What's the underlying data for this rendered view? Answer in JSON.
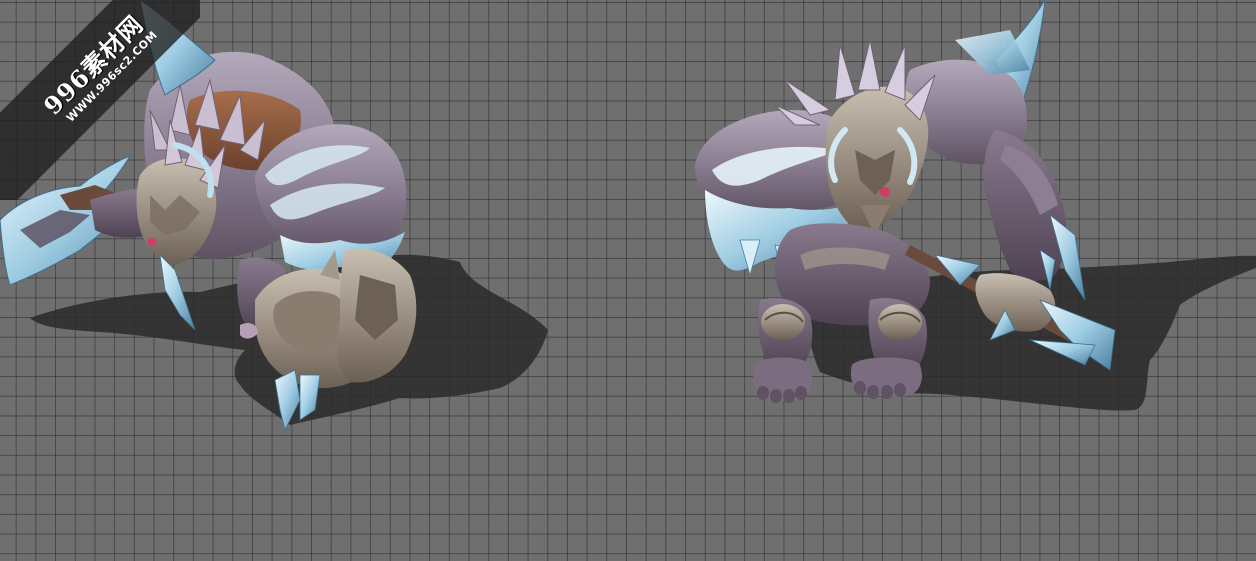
{
  "watermark": {
    "title": "996素材网",
    "url": "WWW.996sc2.COM"
  },
  "scene": {
    "background_color": "#6f6f6f",
    "grid_line_color": "#3a3a3a",
    "models": [
      {
        "name": "ice-beast-left-view"
      },
      {
        "name": "ice-beast-front-view"
      }
    ],
    "palette": {
      "fur_dark": "#6f6272",
      "fur_mid": "#8c7f93",
      "fur_light": "#b3a9bb",
      "ice_light": "#d9eef7",
      "ice_mid": "#8fc3dc",
      "ice_dark": "#4a7ea0",
      "armor": "#a49a8c",
      "armor_dark": "#5b4f45",
      "leather": "#8a5a3f",
      "gem": "#d23a6a",
      "shadow": "#2b2b2b"
    }
  }
}
